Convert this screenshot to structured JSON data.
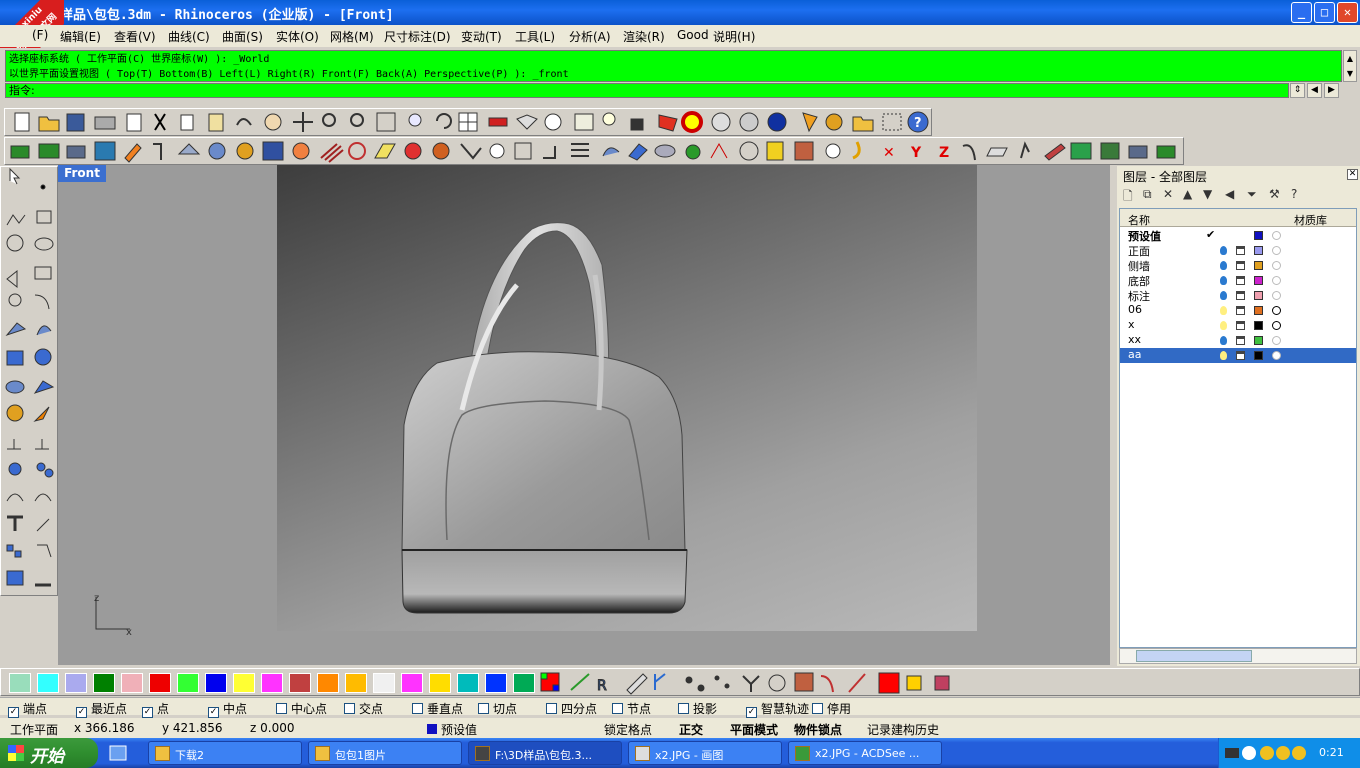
{
  "window": {
    "title": "样品\\包包.3dm - Rhinoceros (企业版) - [Front]",
    "min": "_",
    "max": "□",
    "close": "✕"
  },
  "watermark": {
    "line1": "xuexiniu",
    "line2": "学犀牛中文网"
  },
  "menu": [
    "(F)",
    "编辑(E)",
    "查看(V)",
    "曲线(C)",
    "曲面(S)",
    "实体(O)",
    "网格(M)",
    "尺寸标注(D)",
    "变动(T)",
    "工具(L)",
    "分析(A)",
    "渲染(R)",
    "Good",
    "说明(H)"
  ],
  "command": {
    "history1": "选择座标系统 ( 工作平面(C) 世界座标(W) ): _World",
    "history2": "以世界平面设置视图 ( Top(T) Bottom(B) Left(L) Right(R) Front(F) Back(A) Perspective(P) ): _front",
    "prompt": "指令"
  },
  "viewport": {
    "tab": "Front",
    "axis_z": "z",
    "axis_x": "x"
  },
  "layers": {
    "title": "图层 - 全部图层",
    "col_name": "名称",
    "col_material": "材质库",
    "rows": [
      {
        "name": "预设值",
        "current": "✔",
        "color": "#1010c0"
      },
      {
        "name": "正面",
        "color": "#9999ee"
      },
      {
        "name": "侧墙",
        "color": "#e0a020"
      },
      {
        "name": "底部",
        "color": "#cc22cc"
      },
      {
        "name": "标注",
        "color": "#f0a0b0"
      },
      {
        "name": "06",
        "color": "#e07020"
      },
      {
        "name": "x",
        "color": "#000000"
      },
      {
        "name": "xx",
        "color": "#40c040"
      },
      {
        "name": "aa",
        "color": "#000000",
        "selected": true
      }
    ]
  },
  "colors": [
    "#99ddbb",
    "#33ffff",
    "#aaaaee",
    "#008000",
    "#f0b0b8",
    "#ee0000",
    "#33ff33",
    "#0000ee",
    "#ffff33",
    "#ff33ff",
    "#c04040",
    "#ff8800",
    "#ffbb00",
    "#f0f0f0",
    "#ff33ff",
    "#ffdd00",
    "#00bbbb",
    "#0033ff",
    "#00aa55"
  ],
  "osnap": [
    {
      "label": "端点",
      "checked": true
    },
    {
      "label": "最近点",
      "checked": true
    },
    {
      "label": "点",
      "checked": true
    },
    {
      "label": "中点",
      "checked": true
    },
    {
      "label": "中心点",
      "checked": false
    },
    {
      "label": "交点",
      "checked": false
    },
    {
      "label": "垂直点",
      "checked": false
    },
    {
      "label": "切点",
      "checked": false
    },
    {
      "label": "四分点",
      "checked": false
    },
    {
      "label": "节点",
      "checked": false
    },
    {
      "label": "投影",
      "checked": false
    },
    {
      "label": "智慧轨迹",
      "checked": true
    },
    {
      "label": "停用",
      "checked": false
    }
  ],
  "status": {
    "plane": "工作平面",
    "x": "x 366.186",
    "y": "y 421.856",
    "z": "z 0.000",
    "layer": "预设值",
    "snap": "锁定格点",
    "ortho": "正交",
    "planar": "平面模式",
    "osnap": "物件锁点",
    "history": "记录建构历史"
  },
  "taskbar": {
    "start": "开始",
    "tasks": [
      "下载2",
      "包包1图片",
      "F:\\3D样品\\包包.3...",
      "x2.JPG - 画图",
      "x2.JPG - ACDSee ..."
    ],
    "clock": "0:21"
  }
}
